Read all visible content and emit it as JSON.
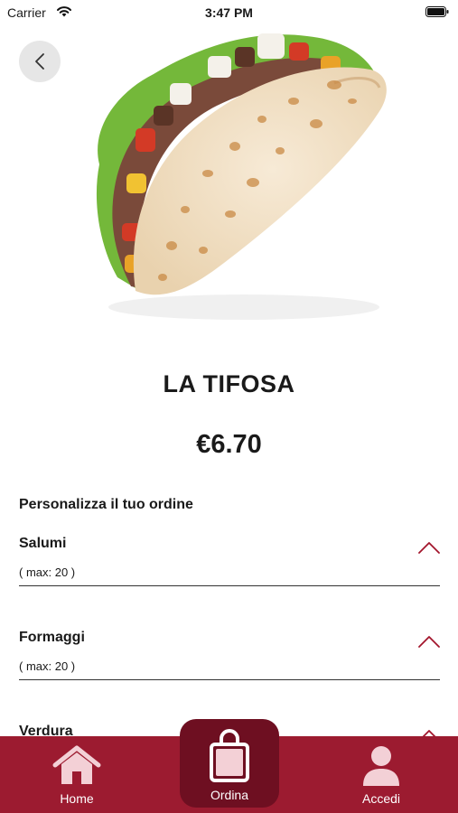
{
  "status_bar": {
    "carrier": "Carrier",
    "time": "3:47 PM"
  },
  "product": {
    "name": "LA TIFOSA",
    "price": "€6.70"
  },
  "customize": {
    "title": "Personalizza il tuo ordine",
    "groups": [
      {
        "name": "Salumi",
        "max": "( max: 20 )"
      },
      {
        "name": "Formaggi",
        "max": "( max: 20 )"
      },
      {
        "name": "Verdura",
        "max": ""
      }
    ]
  },
  "tabbar": {
    "items": [
      {
        "label": "Home",
        "icon": "home-icon"
      },
      {
        "label": "Ordina",
        "icon": "shopping-bag-icon"
      },
      {
        "label": "Accedi",
        "icon": "user-icon"
      }
    ]
  },
  "colors": {
    "brand": "#9c1b30",
    "brand_dark": "#6e0f21",
    "accent_chevron": "#a3162c"
  }
}
